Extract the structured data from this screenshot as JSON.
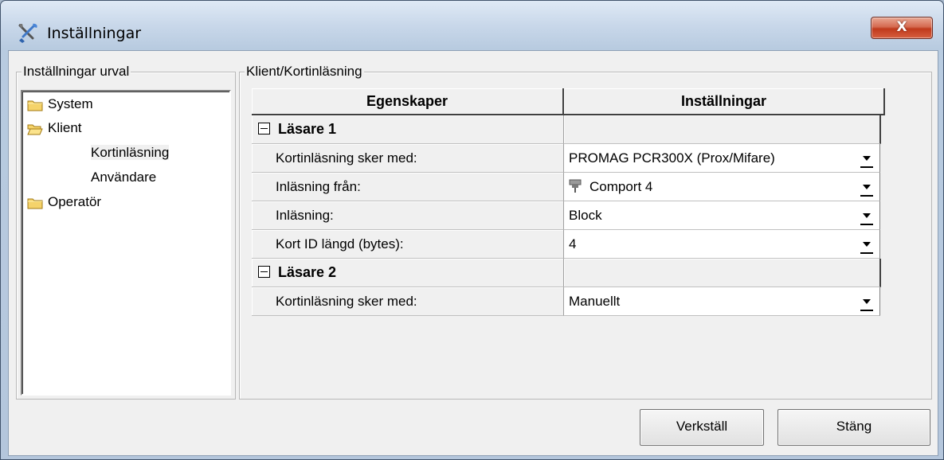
{
  "window": {
    "title": "Inställningar",
    "close_label": "X"
  },
  "left_group": {
    "legend": "Inställningar urval",
    "tree": [
      {
        "label": "System",
        "icon": "folder-closed-icon",
        "level": 0
      },
      {
        "label": "Klient",
        "icon": "folder-open-icon",
        "level": 0
      },
      {
        "label": "Kortinläsning",
        "icon": "",
        "level": 1,
        "selected": true
      },
      {
        "label": "Användare",
        "icon": "",
        "level": 1
      },
      {
        "label": "Operatör",
        "icon": "folder-closed-icon",
        "level": 0
      }
    ]
  },
  "right_group": {
    "legend": "Klient/Kortinläsning",
    "columns": {
      "property": "Egenskaper",
      "value": "Inställningar"
    },
    "rows": [
      {
        "type": "section",
        "label": "Läsare 1",
        "toggle": "-"
      },
      {
        "type": "prop",
        "label": "Kortinläsning sker med:",
        "value": "PROMAG PCR300X (Prox/Mifare)"
      },
      {
        "type": "prop",
        "label": "Inläsning från:",
        "value": "Comport 4",
        "icon": "plug-icon"
      },
      {
        "type": "prop",
        "label": "Inläsning:",
        "value": "Block"
      },
      {
        "type": "prop",
        "label": "Kort ID längd (bytes):",
        "value": "4"
      },
      {
        "type": "section",
        "label": "Läsare 2",
        "toggle": "-"
      },
      {
        "type": "prop",
        "label": "Kortinläsning sker med:",
        "value": "Manuellt"
      }
    ]
  },
  "buttons": {
    "apply": "Verkställ",
    "close": "Stäng"
  },
  "colors": {
    "close_button": "#c9462b",
    "title_gradient_top": "#dfe9f5"
  }
}
